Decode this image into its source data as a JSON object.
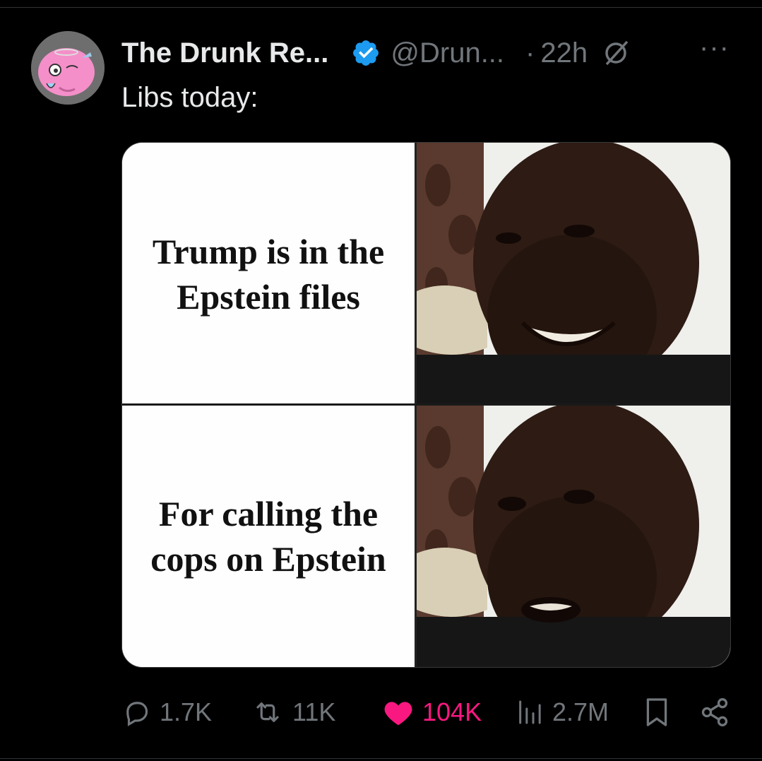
{
  "tweet": {
    "display_name": "The Drunk Re...",
    "handle": "@Drun...",
    "separator": "·",
    "time": "22h",
    "more": "···",
    "text": "Libs today:"
  },
  "meme": {
    "top_caption": "Trump is in the Epstein files",
    "bottom_caption": "For calling the cops on Epstein"
  },
  "actions": {
    "replies": "1.7K",
    "reposts": "11K",
    "likes": "104K",
    "views": "2.7M"
  },
  "colors": {
    "background": "#000000",
    "primary_text": "#e7e9ea",
    "secondary_text": "#71767b",
    "like": "#f91880",
    "verified": "#1d9bf0"
  },
  "icons": [
    "reply-icon",
    "repost-icon",
    "like-icon",
    "views-icon",
    "bookmark-icon",
    "share-icon",
    "verified-icon",
    "grok-icon"
  ]
}
